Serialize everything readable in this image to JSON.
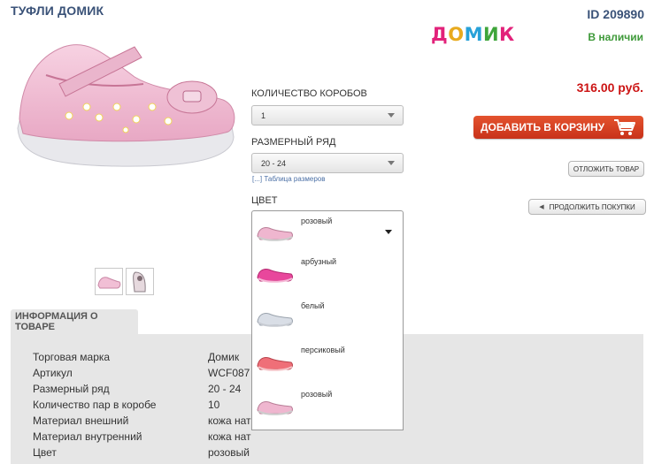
{
  "product": {
    "title": "ТУФЛИ ДОМИК",
    "id_text": "ID 209890",
    "brand_logo": {
      "letters": [
        "Д",
        "О",
        "М",
        "И",
        "К"
      ],
      "colors": [
        "#e2227a",
        "#e8aa1e",
        "#27a1d8",
        "#3ea53a",
        "#e2227a"
      ]
    },
    "stock": "В наличии",
    "price": "316.00 руб."
  },
  "actions": {
    "add_to_cart": "ДОБАВИТЬ В КОРЗИНУ",
    "defer": "ОТЛОЖИТЬ ТОВАР",
    "continue": "ПРОДОЛЖИТЬ ПОКУПКИ"
  },
  "options": {
    "boxes_label": "КОЛИЧЕСТВО КОРОБОВ",
    "boxes_value": "1",
    "size_label": "РАЗМЕРНЫЙ РЯД",
    "size_value": "20 - 24",
    "size_table_link": "[...] Таблица размеров",
    "color_label": "ЦВЕТ",
    "color_selected": "розовый",
    "color_options": [
      {
        "label": "арбузный",
        "color": "#e8479c"
      },
      {
        "label": "белый",
        "color": "#d9dee6"
      },
      {
        "label": "персиковый",
        "color": "#ef6f78"
      },
      {
        "label": "розовый",
        "color": "#efb6cf"
      }
    ]
  },
  "info": {
    "tab_label": "ИНФОРМАЦИЯ О ТОВАРЕ",
    "specs": [
      {
        "key": "Торговая марка",
        "value": "Домик"
      },
      {
        "key": "Артикул",
        "value": "WCF087"
      },
      {
        "key": "Размерный ряд",
        "value": "20 - 24"
      },
      {
        "key": "Количество пар в коробе",
        "value": "10"
      },
      {
        "key": "Материал внешний",
        "value": "кожа нат"
      },
      {
        "key": "Материал внутренний",
        "value": "кожа нат"
      },
      {
        "key": "Цвет",
        "value": "розовый"
      }
    ]
  },
  "theme": {
    "title_color": "#3a5278",
    "price_color": "#cc1414",
    "stock_color": "#3f9a3a",
    "cart_button": "#d43d20"
  }
}
